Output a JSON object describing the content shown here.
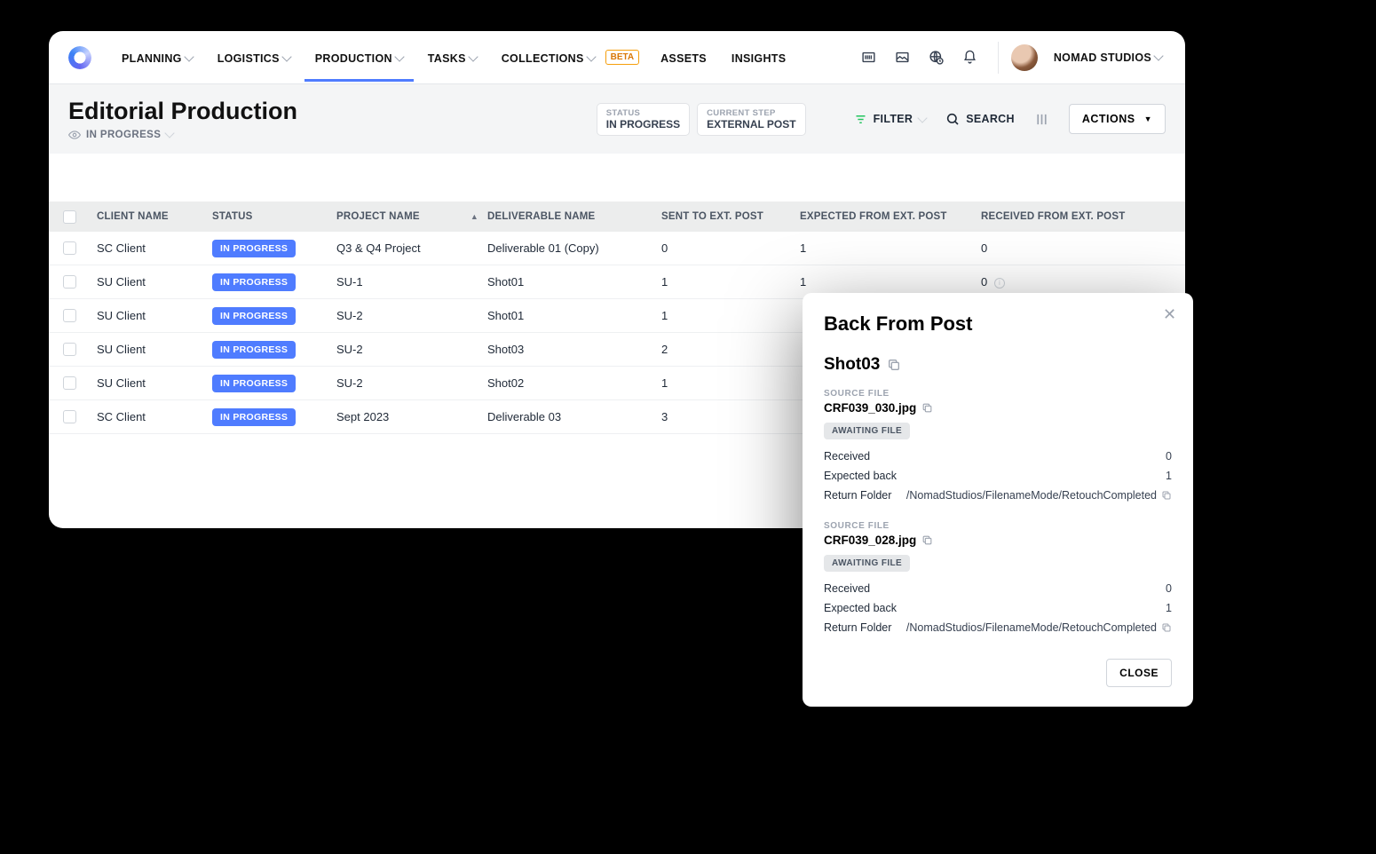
{
  "nav": {
    "items": [
      {
        "label": "PLANNING",
        "dropdown": true
      },
      {
        "label": "LOGISTICS",
        "dropdown": true
      },
      {
        "label": "PRODUCTION",
        "dropdown": true,
        "active": true
      },
      {
        "label": "TASKS",
        "dropdown": true
      },
      {
        "label": "COLLECTIONS",
        "dropdown": true,
        "beta": true
      },
      {
        "label": "ASSETS",
        "dropdown": false
      },
      {
        "label": "INSIGHTS",
        "dropdown": false
      }
    ],
    "beta_label": "BETA",
    "org": "NOMAD STUDIOS"
  },
  "page": {
    "title": "Editorial Production",
    "status_label": "IN PROGRESS",
    "status_pill": {
      "label": "STATUS",
      "value": "IN PROGRESS"
    },
    "step_pill": {
      "label": "CURRENT STEP",
      "value": "EXTERNAL POST"
    },
    "filter_label": "FILTER",
    "search_label": "SEARCH",
    "actions_label": "ACTIONS"
  },
  "table": {
    "headers": {
      "client": "CLIENT NAME",
      "status": "STATUS",
      "project": "PROJECT NAME",
      "deliverable": "DELIVERABLE NAME",
      "sent": "SENT TO EXT. POST",
      "expected": "EXPECTED FROM EXT. POST",
      "received": "RECEIVED FROM EXT. POST"
    },
    "rows": [
      {
        "client": "SC Client",
        "status": "IN PROGRESS",
        "project": "Q3 & Q4 Project",
        "deliverable": "Deliverable 01 (Copy)",
        "sent": "0",
        "expected": "1",
        "received": "0"
      },
      {
        "client": "SU Client",
        "status": "IN PROGRESS",
        "project": "SU-1",
        "deliverable": "Shot01",
        "sent": "1",
        "expected": "1",
        "received": "0",
        "received_info": true
      },
      {
        "client": "SU Client",
        "status": "IN PROGRESS",
        "project": "SU-2",
        "deliverable": "Shot01",
        "sent": "1",
        "expected": "",
        "received": ""
      },
      {
        "client": "SU Client",
        "status": "IN PROGRESS",
        "project": "SU-2",
        "deliverable": "Shot03",
        "sent": "2",
        "expected": "",
        "received": ""
      },
      {
        "client": "SU Client",
        "status": "IN PROGRESS",
        "project": "SU-2",
        "deliverable": "Shot02",
        "sent": "1",
        "expected": "",
        "received": ""
      },
      {
        "client": "SC Client",
        "status": "IN PROGRESS",
        "project": "Sept 2023",
        "deliverable": "Deliverable 03",
        "sent": "3",
        "expected": "",
        "received": ""
      }
    ]
  },
  "modal": {
    "title": "Back From Post",
    "subject": "Shot03",
    "source_file_label": "SOURCE FILE",
    "awaiting_label": "AWAITING FILE",
    "received_label": "Received",
    "expected_label": "Expected back",
    "return_folder_label": "Return Folder",
    "close_label": "CLOSE",
    "files": [
      {
        "name": "CRF039_030.jpg",
        "status": "AWAITING FILE",
        "received": "0",
        "expected": "1",
        "folder": "/NomadStudios/FilenameMode/RetouchCompleted"
      },
      {
        "name": "CRF039_028.jpg",
        "status": "AWAITING FILE",
        "received": "0",
        "expected": "1",
        "folder": "/NomadStudios/FilenameMode/RetouchCompleted"
      }
    ]
  }
}
